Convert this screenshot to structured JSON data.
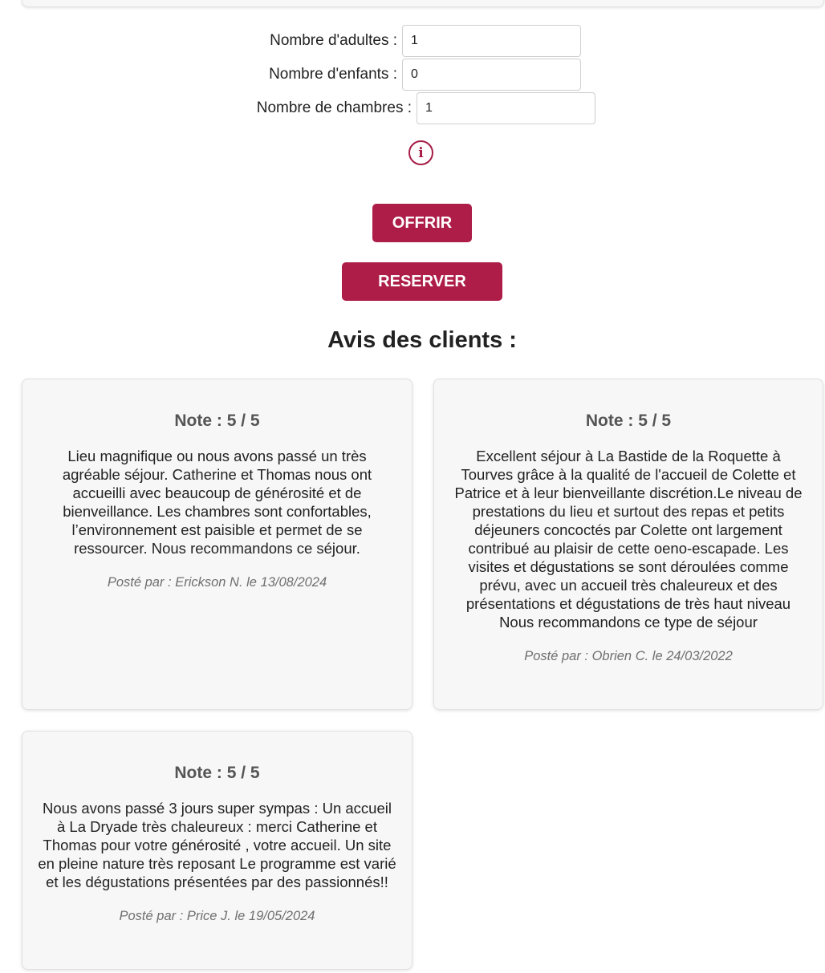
{
  "form": {
    "adults_label": "Nombre d'adultes :",
    "adults_value": "1",
    "children_label": "Nombre d'enfants :",
    "children_value": "0",
    "rooms_label": "Nombre de chambres :",
    "rooms_value": "1",
    "info_icon_glyph": "i"
  },
  "buttons": {
    "offer_label": "OFFRIR",
    "reserve_label": "RESERVER"
  },
  "reviews": {
    "title": "Avis des clients :",
    "items": [
      {
        "note": "Note : 5 / 5",
        "text": "Lieu magnifique ou nous avons passé un très agréable séjour. Catherine et Thomas nous ont accueilli avec beaucoup de générosité et de bienveillance. Les chambres sont confortables, l’environnement est paisible et permet de se ressourcer. Nous recommandons ce séjour.",
        "author": "Posté par : Erickson N. le 13/08/2024"
      },
      {
        "note": "Note : 5 / 5",
        "text": "Excellent séjour à La Bastide de la Roquette à Tourves grâce à la qualité de l'accueil de Colette et Patrice et à leur bienveillante discrétion.Le niveau de prestations du lieu et surtout des repas et petits déjeuners concoctés par Colette ont largement contribué au plaisir de cette oeno-escapade. Les visites et dégustations se sont déroulées comme prévu, avec un accueil très chaleureux et des présentations et dégustations de très haut niveau Nous recommandons ce type de séjour",
        "author": "Posté par : Obrien C. le 24/03/2022"
      },
      {
        "note": "Note : 5 / 5",
        "text": "Nous avons passé 3 jours super sympas : Un accueil à La Dryade très chaleureux : merci Catherine et Thomas pour votre générosité , votre accueil. Un site en pleine nature très reposant Le programme est varié et les dégustations présentées par des passionnés!!",
        "author": "Posté par : Price J. le 19/05/2024"
      }
    ]
  },
  "colors": {
    "accent": "#ad1d48",
    "card_background": "#f7f7f7",
    "note_text": "#555555",
    "author_text": "#6f6f6f"
  },
  "icons": {
    "info": "info-icon"
  }
}
